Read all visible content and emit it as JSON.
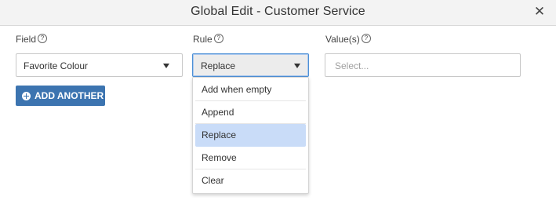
{
  "dialog": {
    "title": "Global Edit - Customer Service",
    "close_glyph": "✕"
  },
  "labels": {
    "field": "Field",
    "rule": "Rule",
    "values": "Value(s)",
    "help_glyph": "?"
  },
  "field_select": {
    "value": "Favorite Colour"
  },
  "rule_select": {
    "value": "Replace",
    "options": [
      "Add when empty",
      "Append",
      "Replace",
      "Remove",
      "Clear"
    ],
    "selected_index": 2
  },
  "values_input": {
    "placeholder": "Select..."
  },
  "add_button": {
    "label": "ADD ANOTHER"
  },
  "icons": {
    "close": "close-icon",
    "help": "help-icon",
    "dropdown_arrow": "chevron-down-icon",
    "add": "plus-circle-icon"
  },
  "colors": {
    "accent": "#3c74b0",
    "selected_option": "#c9dcf8",
    "focus_border": "#4d90d6"
  }
}
